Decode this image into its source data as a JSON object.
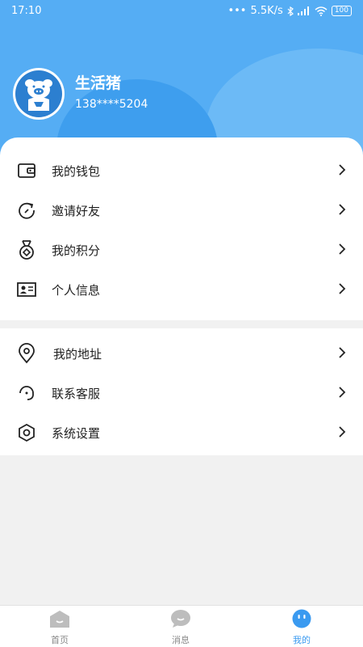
{
  "status_bar": {
    "time": "17:10",
    "network_speed": "5.5K/s",
    "battery": "100"
  },
  "profile": {
    "name": "生活猪",
    "phone": "138****5204"
  },
  "menu_group1": [
    {
      "label": "我的钱包",
      "icon": "wallet-icon"
    },
    {
      "label": "邀请好友",
      "icon": "invite-icon"
    },
    {
      "label": "我的积分",
      "icon": "medal-icon"
    },
    {
      "label": "个人信息",
      "icon": "id-card-icon"
    }
  ],
  "menu_group2": [
    {
      "label": "我的地址",
      "icon": "location-pin-icon"
    },
    {
      "label": "联系客服",
      "icon": "headset-icon"
    },
    {
      "label": "系统设置",
      "icon": "settings-hexagon-icon"
    }
  ],
  "bottom_nav": [
    {
      "label": "首页",
      "icon": "home-icon",
      "active": false
    },
    {
      "label": "消息",
      "icon": "message-icon",
      "active": false
    },
    {
      "label": "我的",
      "icon": "profile-icon",
      "active": true
    }
  ],
  "colors": {
    "header_blue": "#55adf4",
    "accent": "#3a9af0",
    "nav_inactive": "#bdbdbd"
  }
}
